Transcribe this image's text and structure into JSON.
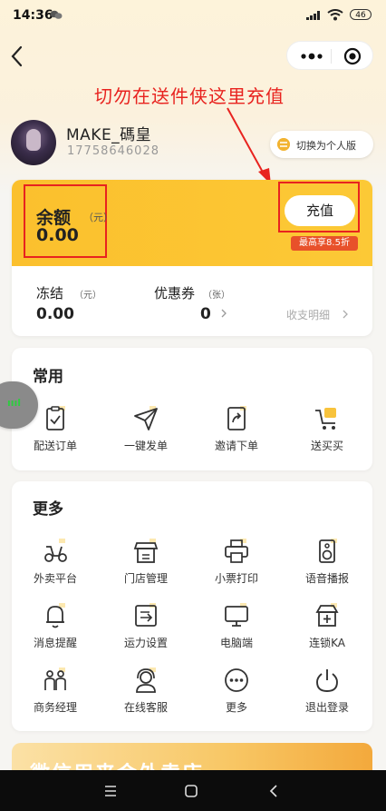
{
  "status_bar": {
    "time": "14:36",
    "battery": "46"
  },
  "annotation": {
    "text": "切勿在送件侠这里充值"
  },
  "profile": {
    "username": "MAKE_碼皇",
    "phone": "17758646028",
    "switch_label": "切换为个人版"
  },
  "balance": {
    "label": "余额",
    "unit": "（元）",
    "value": "0.00",
    "recharge_label": "充值",
    "discount": "最高享8.5折"
  },
  "frozen": {
    "label": "冻结",
    "unit": "（元）",
    "value": "0.00"
  },
  "coupons": {
    "label": "优惠券",
    "unit": "（张）",
    "value": "0"
  },
  "detail_link": "收支明细",
  "common": {
    "title": "常用",
    "items": [
      {
        "label": "配送订单",
        "icon": "clipboard-check-icon"
      },
      {
        "label": "一键发单",
        "icon": "paper-plane-icon"
      },
      {
        "label": "邀请下单",
        "icon": "share-document-icon"
      },
      {
        "label": "送买买",
        "icon": "shopping-cart-icon"
      }
    ]
  },
  "more": {
    "title": "更多",
    "items": [
      {
        "label": "外卖平台",
        "icon": "scooter-icon"
      },
      {
        "label": "门店管理",
        "icon": "store-icon"
      },
      {
        "label": "小票打印",
        "icon": "printer-icon"
      },
      {
        "label": "语音播报",
        "icon": "speaker-icon"
      },
      {
        "label": "消息提醒",
        "icon": "bell-icon"
      },
      {
        "label": "运力设置",
        "icon": "transport-settings-icon"
      },
      {
        "label": "电脑端",
        "icon": "monitor-icon"
      },
      {
        "label": "连锁KA",
        "icon": "chain-store-icon"
      },
      {
        "label": "商务经理",
        "icon": "business-manager-icon"
      },
      {
        "label": "在线客服",
        "icon": "headset-icon"
      },
      {
        "label": "更多",
        "icon": "more-dots-icon"
      },
      {
        "label": "退出登录",
        "icon": "power-icon"
      }
    ]
  },
  "float_ball": {
    "label": "ıııl"
  },
  "promo_banner": {
    "text": "微信用来会外卖店"
  },
  "colors": {
    "accent": "#fbc02d",
    "annotation_red": "#e8231f",
    "discount_bg": "#e8512a"
  }
}
